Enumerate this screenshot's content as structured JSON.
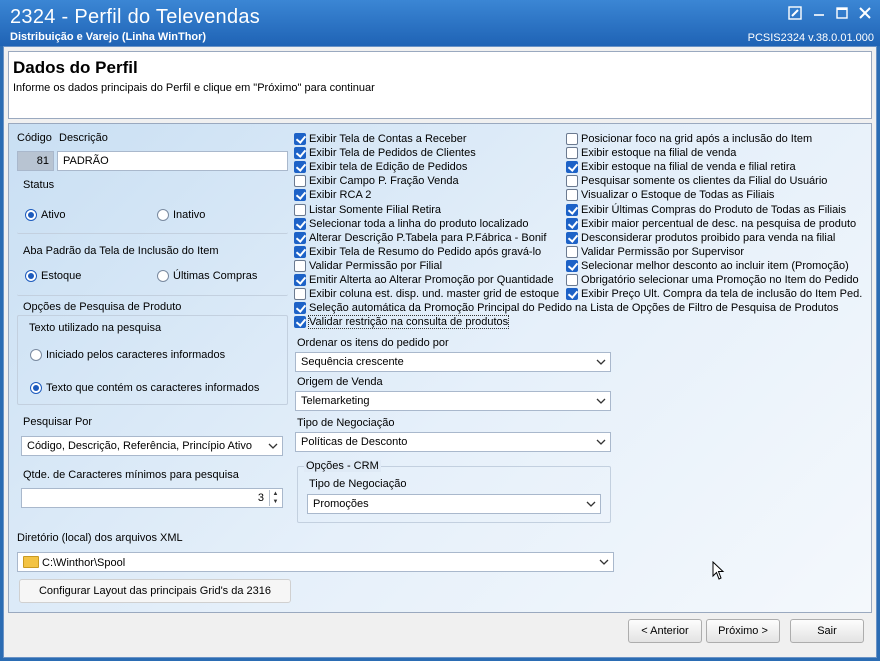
{
  "window": {
    "title": "2324 - Perfil do Televendas",
    "subtitle": "Distribuição e Varejo (Linha WinThor)",
    "version": "PCSIS2324  v.38.0.01.000",
    "controls": [
      "edit-icon",
      "minimize-icon",
      "maximize-icon",
      "close-icon"
    ]
  },
  "header": {
    "title": "Dados do Perfil",
    "instruction": "Informe os dados principais do Perfil e clique em \"Próximo\" para continuar"
  },
  "form": {
    "codigo_label": "Código",
    "descricao_label": "Descrição",
    "codigo_value": "81",
    "descricao_value": "PADRÃO",
    "status": {
      "label": "Status",
      "options": [
        "Ativo",
        "Inativo"
      ],
      "selected": "Ativo"
    },
    "aba_padrao": {
      "label": "Aba Padrão da Tela de Inclusão do Item",
      "options": [
        "Estoque",
        "Últimas Compras"
      ],
      "selected": "Estoque"
    },
    "opcoes_pesquisa": {
      "label": "Opções de Pesquisa de Produto",
      "texto_label": "Texto utilizado na pesquisa",
      "options": [
        "Iniciado pelos caracteres informados",
        "Texto que contém os caracteres informados"
      ],
      "selected": "Texto que contém os caracteres informados"
    },
    "pesquisar_por": {
      "label": "Pesquisar Por",
      "value": "Código, Descrição, Referência, Princípio Ativo"
    },
    "qtde_caracteres": {
      "label": "Qtde. de Caracteres mínimos para pesquisa",
      "value": "3"
    },
    "diretorio": {
      "label": "Diretório (local) dos arquivos XML",
      "value": "C:\\Winthor\\Spool"
    },
    "config_button": "Configurar Layout das principais Grid's da 2316"
  },
  "checkboxes_left": [
    {
      "label": "Exibir Tela de Contas a Receber",
      "checked": true
    },
    {
      "label": "Exibir Tela de Pedidos de Clientes",
      "checked": true
    },
    {
      "label": "Exibir tela de Edição de Pedidos",
      "checked": true
    },
    {
      "label": "Exibir Campo P. Fração Venda",
      "checked": false
    },
    {
      "label": "Exibir RCA 2",
      "checked": true
    },
    {
      "label": "Listar Somente Filial Retira",
      "checked": false
    },
    {
      "label": "Selecionar toda a linha do produto localizado",
      "checked": true
    },
    {
      "label": "Alterar Descrição P.Tabela para P.Fábrica - Bonif",
      "checked": true
    },
    {
      "label": "Exibir Tela de Resumo do Pedido após gravá-lo",
      "checked": true
    },
    {
      "label": "Validar Permissão por Filial",
      "checked": false
    },
    {
      "label": "Emitir Alterta ao Alterar Promoção por Quantidade",
      "checked": true
    },
    {
      "label": "Exibir coluna est. disp. und. master grid de estoque",
      "checked": false
    }
  ],
  "checkboxes_right": [
    {
      "label": "Posicionar foco na grid após a inclusão do Item",
      "checked": false
    },
    {
      "label": "Exibir estoque na filial de venda",
      "checked": false
    },
    {
      "label": "Exibir estoque na filial de venda e filial retira",
      "checked": true
    },
    {
      "label": "Pesquisar somente os clientes da Filial do Usuário",
      "checked": false
    },
    {
      "label": "Visualizar o Estoque de Todas as Filiais",
      "checked": false
    },
    {
      "label": "Exibir Últimas Compras do Produto de Todas as Filiais",
      "checked": true
    },
    {
      "label": "Exibir maior percentual de desc. na pesquisa de produto",
      "checked": true
    },
    {
      "label": "Desconsiderar produtos proibido para venda na filial",
      "checked": true
    },
    {
      "label": "Validar Permissão por Supervisor",
      "checked": false
    },
    {
      "label": "Selecionar melhor desconto ao incluir item (Promoção)",
      "checked": true
    },
    {
      "label": "Obrigatório selecionar uma Promoção no Item do Pedido",
      "checked": false
    },
    {
      "label": "Exibir Preço Ult. Compra da tela de inclusão do Item Ped.",
      "checked": true
    }
  ],
  "checkboxes_wide": [
    {
      "label": "Seleção automática da Promoção Principal do Pedido na Lista de Opções de Filtro de Pesquisa de Produtos",
      "checked": true
    },
    {
      "label": "Validar restrição na consulta de produtos",
      "checked": true
    }
  ],
  "dropdowns": {
    "ordenar": {
      "label": "Ordenar os itens do pedido por",
      "value": "Sequência crescente"
    },
    "origem": {
      "label": "Origem de Venda",
      "value": "Telemarketing"
    },
    "tipo_negociacao": {
      "label": "Tipo de Negociação",
      "value": "Políticas de Desconto"
    },
    "crm": {
      "label": "Opções - CRM",
      "tipo_label": "Tipo de Negociação",
      "value": "Promoções"
    }
  },
  "footer": {
    "anterior": "< Anterior",
    "proximo": "Próximo >",
    "sair": "Sair"
  }
}
